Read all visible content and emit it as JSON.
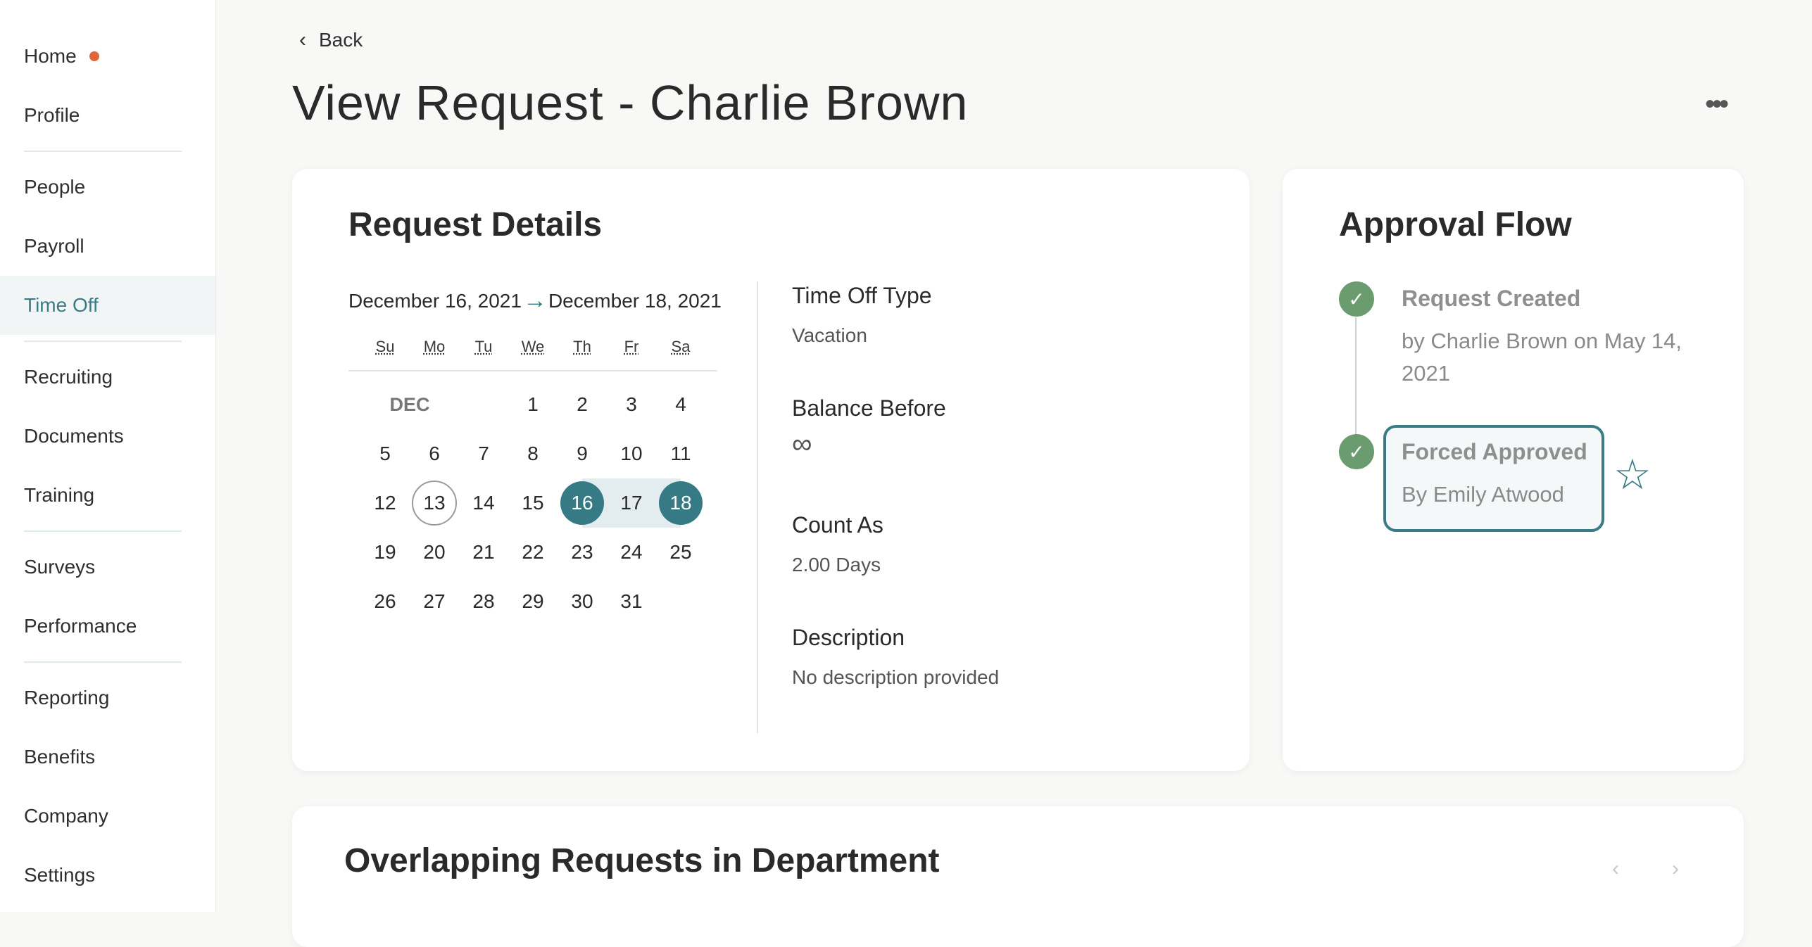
{
  "sidebar": {
    "items": [
      {
        "label": "Home"
      },
      {
        "label": "Profile"
      },
      {
        "label": "People"
      },
      {
        "label": "Payroll"
      },
      {
        "label": "Time Off"
      },
      {
        "label": "Recruiting"
      },
      {
        "label": "Documents"
      },
      {
        "label": "Training"
      },
      {
        "label": "Surveys"
      },
      {
        "label": "Performance"
      },
      {
        "label": "Reporting"
      },
      {
        "label": "Benefits"
      },
      {
        "label": "Company"
      },
      {
        "label": "Settings"
      }
    ],
    "active": "Time Off",
    "home_dot_color": "#e0663a"
  },
  "header": {
    "back_label": "Back",
    "title": "View Request - Charlie Brown",
    "more_icon": "ellipsis-icon"
  },
  "request_details": {
    "title": "Request Details",
    "start_date": "December 16, 2021",
    "end_date": "December 18, 2021",
    "calendar": {
      "weekdays": [
        "Su",
        "Mo",
        "Tu",
        "We",
        "Th",
        "Fr",
        "Sa"
      ],
      "month_label": "DEC",
      "today": 13,
      "selected_start": 16,
      "selected_end": 18,
      "days_in_month": 31,
      "first_weekday_index": 3
    },
    "fields": {
      "type_label": "Time Off Type",
      "type_value": "Vacation",
      "balance_label": "Balance Before",
      "balance_value": "∞",
      "count_label": "Count As",
      "count_value": "2.00 Days",
      "desc_label": "Description",
      "desc_value": "No description provided"
    }
  },
  "approval_flow": {
    "title": "Approval Flow",
    "steps": [
      {
        "title": "Request Created",
        "line1": "by Charlie Brown on May 14,",
        "line2": "2021"
      },
      {
        "title": "Forced Approved",
        "line1": "By Emily Atwood"
      }
    ]
  },
  "overlapping": {
    "title": "Overlapping Requests in Department"
  },
  "colors": {
    "accent": "#357a84",
    "check_green": "#6b9c6f"
  }
}
